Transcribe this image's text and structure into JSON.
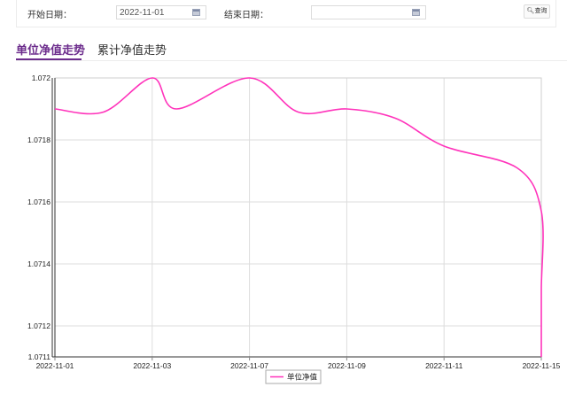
{
  "filters": {
    "start_label": "开始日期：",
    "start_value": "2022-11-01",
    "end_label": "结束日期：",
    "end_value": "",
    "query_label": "查询"
  },
  "tabs": [
    {
      "label": "单位净值走势",
      "active": true
    },
    {
      "label": "累计净值走势",
      "active": false
    }
  ],
  "chart_data": {
    "type": "line",
    "x_tick_labels": [
      "2022-11-01",
      "2022-11-03",
      "2022-11-07",
      "2022-11-09",
      "2022-11-11",
      "2022-11-15"
    ],
    "y_tick_labels": [
      "1.072",
      "1.0718",
      "1.0716",
      "1.0714",
      "1.0712",
      "1.0711"
    ],
    "ylim": [
      1.0711,
      1.072
    ],
    "grid": true,
    "legend_position": "bottom-center",
    "series": [
      {
        "name": "单位净值",
        "color": "#ff33bb",
        "points": [
          {
            "x": "2022-11-01",
            "y": 1.0719
          },
          {
            "x": "2022-11-02",
            "y": 1.07189
          },
          {
            "x": "2022-11-03",
            "y": 1.072
          },
          {
            "x": "2022-11-04",
            "y": 1.0719
          },
          {
            "x": "2022-11-07",
            "y": 1.072
          },
          {
            "x": "2022-11-08",
            "y": 1.07189
          },
          {
            "x": "2022-11-09",
            "y": 1.0719
          },
          {
            "x": "2022-11-10",
            "y": 1.07187
          },
          {
            "x": "2022-11-11",
            "y": 1.07178
          },
          {
            "x": "2022-11-14",
            "y": 1.07171
          },
          {
            "x": "2022-11-15",
            "y": 1.07157
          },
          {
            "x": "2022-11-16",
            "y": 1.07132
          },
          {
            "x": "2022-11-17",
            "y": 1.07118
          },
          {
            "x": "2022-11-18",
            "y": 1.0711
          }
        ]
      }
    ]
  }
}
